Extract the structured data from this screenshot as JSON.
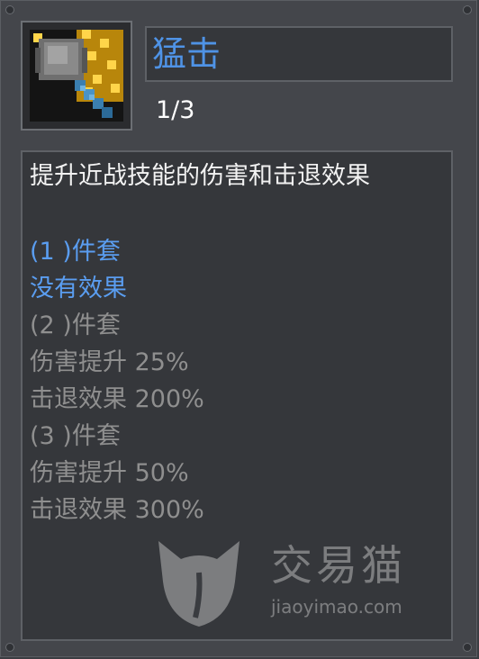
{
  "skill": {
    "name": "猛击",
    "level": "1/3",
    "icon": "hammer-icon",
    "description": "提升近战技能的伤害和击退效果"
  },
  "sets": [
    {
      "header": "(1 )件套",
      "lines": [
        "没有效果"
      ],
      "state": "active"
    },
    {
      "header": "(2 )件套",
      "lines": [
        "伤害提升 25%",
        "击退效果 200%"
      ],
      "state": "inactive"
    },
    {
      "header": "(3 )件套",
      "lines": [
        "伤害提升 50%",
        "击退效果 300%"
      ],
      "state": "inactive"
    }
  ],
  "watermark": {
    "title": "交易猫",
    "url": "jiaoyimao.com"
  },
  "colors": {
    "active": "#5a9df0",
    "inactive": "#8f8f8f",
    "name": "#4f93e6"
  }
}
